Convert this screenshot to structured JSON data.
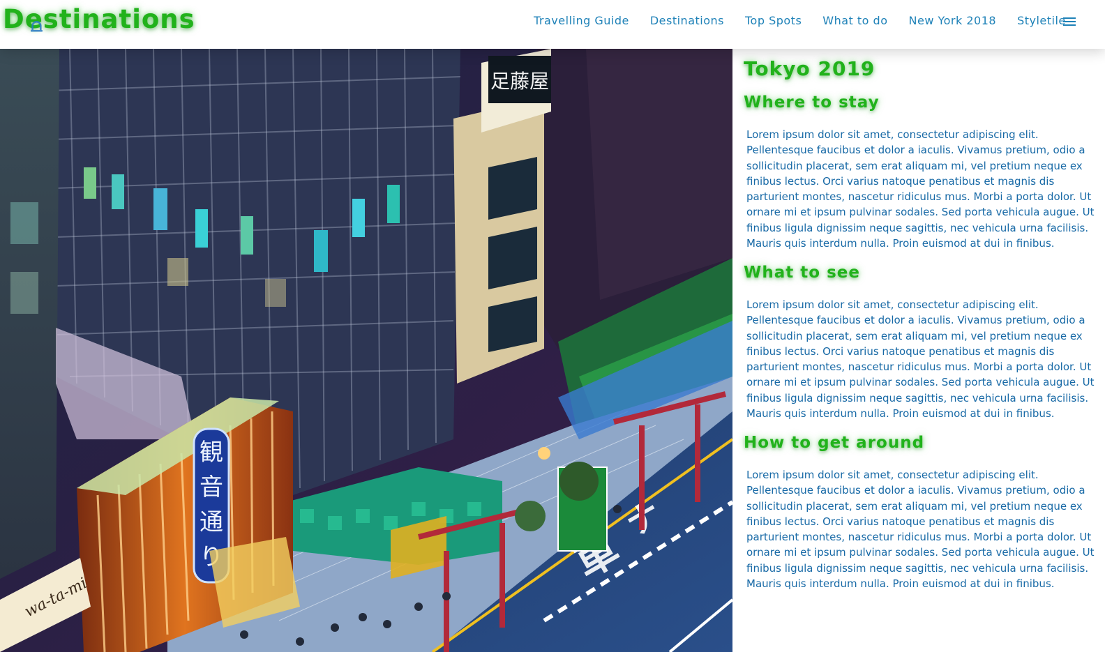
{
  "header": {
    "brand": "Destinations",
    "nav": [
      "Travelling Guide",
      "Destinations",
      "Top Spots",
      "What to do",
      "New York 2018",
      "Styletile"
    ],
    "menu_icon": "hamburger-menu-icon"
  },
  "photo": {
    "sign_text": "wa-ta-mi"
  },
  "article": {
    "title": "Tokyo 2019",
    "sections": [
      {
        "heading": "Where to stay",
        "body": "Lorem ipsum dolor sit amet, consectetur adipiscing elit. Pellentesque faucibus et dolor a iaculis. Vivamus pretium, odio a sollicitudin placerat, sem erat aliquam mi, vel pretium neque ex finibus lectus. Orci varius natoque penatibus et magnis dis parturient montes, nascetur ridiculus mus. Morbi a porta dolor. Ut ornare mi et ipsum pulvinar sodales. Sed porta vehicula augue. Ut finibus ligula dignissim neque sagittis, nec vehicula urna facilisis. Mauris quis interdum nulla. Proin euismod at dui in finibus."
      },
      {
        "heading": "What to see",
        "body": "Lorem ipsum dolor sit amet, consectetur adipiscing elit. Pellentesque faucibus et dolor a iaculis. Vivamus pretium, odio a sollicitudin placerat, sem erat aliquam mi, vel pretium neque ex finibus lectus. Orci varius natoque penatibus et magnis dis parturient montes, nascetur ridiculus mus. Morbi a porta dolor. Ut ornare mi et ipsum pulvinar sodales. Sed porta vehicula augue. Ut finibus ligula dignissim neque sagittis, nec vehicula urna facilisis. Mauris quis interdum nulla. Proin euismod at dui in finibus."
      },
      {
        "heading": "How to get around",
        "body": "Lorem ipsum dolor sit amet, consectetur adipiscing elit. Pellentesque faucibus et dolor a iaculis. Vivamus pretium, odio a sollicitudin placerat, sem erat aliquam mi, vel pretium neque ex finibus lectus. Orci varius natoque penatibus et magnis dis parturient montes, nascetur ridiculus mus. Morbi a porta dolor. Ut ornare mi et ipsum pulvinar sodales. Sed porta vehicula augue. Ut finibus ligula dignissim neque sagittis, nec vehicula urna facilisis. Mauris quis interdum nulla. Proin euismod at dui in finibus."
      }
    ]
  },
  "colors": {
    "heading_green": "#21b21b",
    "nav_blue": "#1f82b8",
    "body_blue": "#1769a6"
  }
}
